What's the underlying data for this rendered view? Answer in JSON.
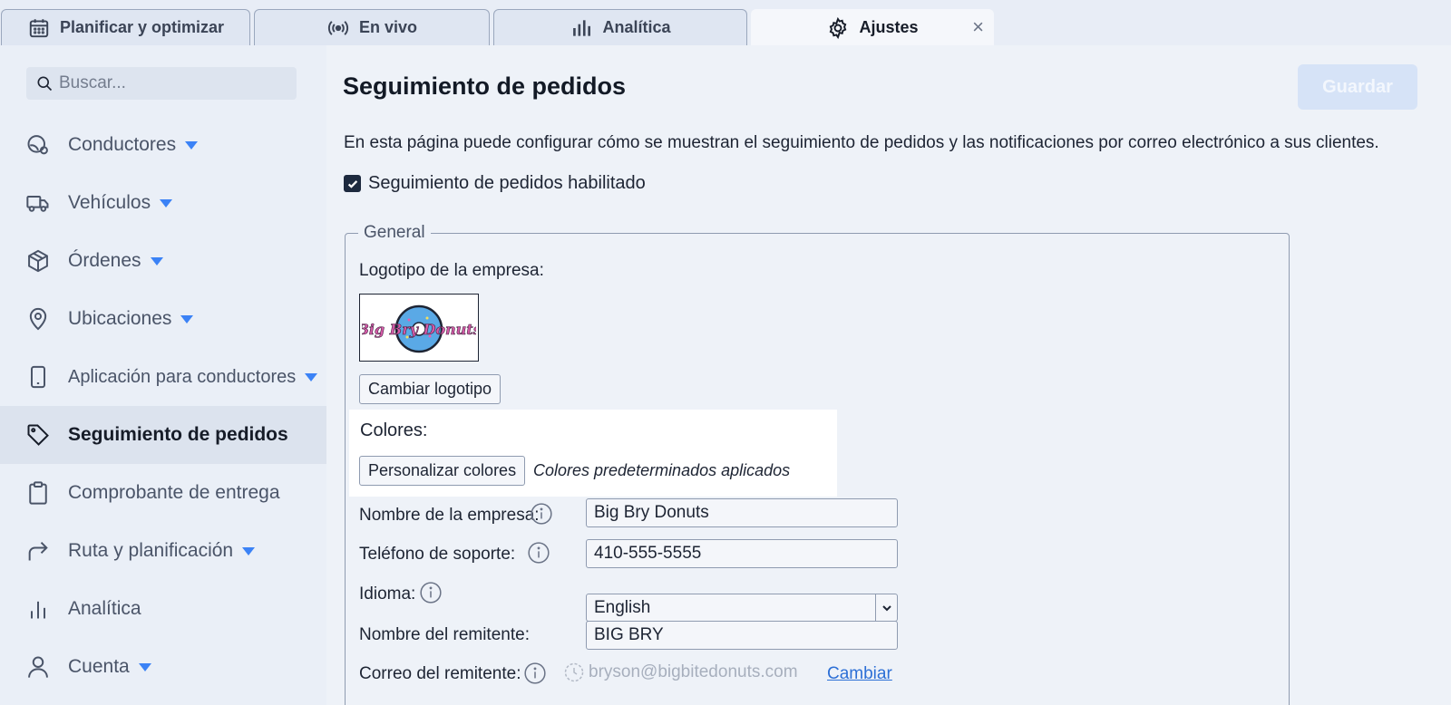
{
  "tabs": [
    {
      "label": "Planificar y optimizar",
      "icon": "calendar-icon"
    },
    {
      "label": "En vivo",
      "icon": "broadcast-icon"
    },
    {
      "label": "Analítica",
      "icon": "bar-chart-icon"
    },
    {
      "label": "Ajustes",
      "icon": "gear-icon",
      "active": true,
      "close": "×"
    }
  ],
  "sidebar": {
    "search_placeholder": "Buscar...",
    "items": [
      {
        "label": "Conductores",
        "icon": "steering-wheel-icon",
        "has_caret": true
      },
      {
        "label": "Vehículos",
        "icon": "truck-icon",
        "has_caret": true
      },
      {
        "label": "Órdenes",
        "icon": "box-icon",
        "has_caret": true
      },
      {
        "label": "Ubicaciones",
        "icon": "map-pin-icon",
        "has_caret": true
      },
      {
        "label": "Aplicación para conductores",
        "icon": "phone-icon",
        "has_caret": true
      },
      {
        "label": "Seguimiento de pedidos",
        "icon": "tag-icon",
        "active": true
      },
      {
        "label": "Comprobante de entrega",
        "icon": "clipboard-icon"
      },
      {
        "label": "Ruta y planificación",
        "icon": "route-arrow-icon",
        "has_caret": true
      },
      {
        "label": "Analítica",
        "icon": "bar-chart-icon"
      },
      {
        "label": "Cuenta",
        "icon": "user-icon",
        "has_caret": true
      }
    ]
  },
  "main": {
    "title": "Seguimiento de pedidos",
    "save_label": "Guardar",
    "description": "En esta página puede configurar cómo se muestran el seguimiento de pedidos y las notificaciones por correo electrónico a sus clientes.",
    "enabled_label": "Seguimiento de pedidos habilitado",
    "enabled": true,
    "general": {
      "legend": "General",
      "logo_label": "Logotipo de la empresa:",
      "logo_text": "Big Bry Donuts",
      "change_logo_label": "Cambiar logotipo",
      "colors_label": "Colores:",
      "customize_colors_label": "Personalizar colores",
      "colors_note": "Colores predeterminados aplicados",
      "company_name_label": "Nombre de la empresa:",
      "company_name_value": "Big Bry Donuts",
      "support_phone_label": "Teléfono de soporte:",
      "support_phone_value": "410-555-5555",
      "language_label": "Idioma:",
      "language_value": "English",
      "sender_name_label": "Nombre del remitente:",
      "sender_name_value": "BIG BRY",
      "sender_email_label": "Correo del remitente:",
      "sender_email_value": "bryson@bigbitedonuts.com",
      "change_email_label": "Cambiar"
    }
  },
  "colors": {
    "accent": "#3b82f6",
    "link": "#2c6fd6",
    "save_disabled": "#d6e3f7"
  }
}
